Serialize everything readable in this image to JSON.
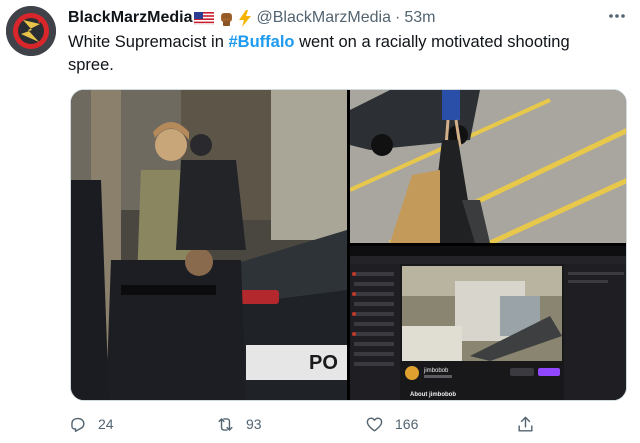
{
  "author": {
    "display_name": "BlackMarzMedia",
    "handle": "@BlackMarzMedia",
    "separator": "·",
    "time": "53m",
    "badges": [
      "us-flag-emoji",
      "raised-fist-emoji",
      "lightning-emoji"
    ]
  },
  "tweet": {
    "text_before": "White Supremacist in ",
    "hashtag": "#Buffalo",
    "text_after": " went on a racially motivated shooting spree."
  },
  "media": {
    "thumb1": "arrest-photo",
    "thumb2": "first-person-shooter-view",
    "thumb3": "livestream-screenshot",
    "m1_car_label": "PO",
    "m3_username": "jimbobob",
    "m3_about": "About jimbobob"
  },
  "actions": {
    "reply_count": "24",
    "retweet_count": "93",
    "like_count": "166"
  },
  "colors": {
    "text": "#0f1419",
    "muted": "#536471",
    "link": "#1d9bf0",
    "border": "#cfd9de"
  },
  "icons": {
    "more": "more-icon",
    "reply": "reply-icon",
    "retweet": "retweet-icon",
    "like": "heart-icon",
    "share": "share-icon"
  }
}
